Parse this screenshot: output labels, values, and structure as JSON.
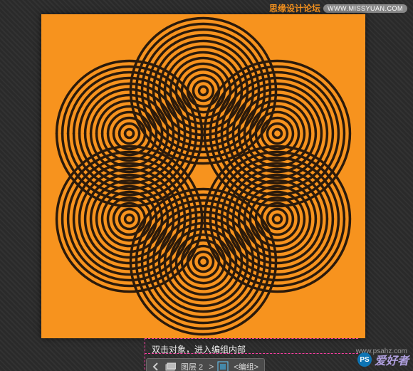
{
  "top_watermark": {
    "text_cn": "思缘设计论坛",
    "url_label": "WWW.MISSYUAN.COM"
  },
  "canvas": {
    "background_color": "#f7931e",
    "stroke_color": "#2b1a0b"
  },
  "bottom": {
    "hint": "双击对象，进入编组内部",
    "layer_label": "图层 2",
    "group_label": "<编组>",
    "gt": ">",
    "arrow_name": "arrow-left-icon",
    "layer_icon_name": "layers-icon",
    "group_icon_name": "group-icon"
  },
  "bottom_watermark": {
    "badge": "PS",
    "text": "爱好者",
    "url": "www.psahz.com"
  }
}
